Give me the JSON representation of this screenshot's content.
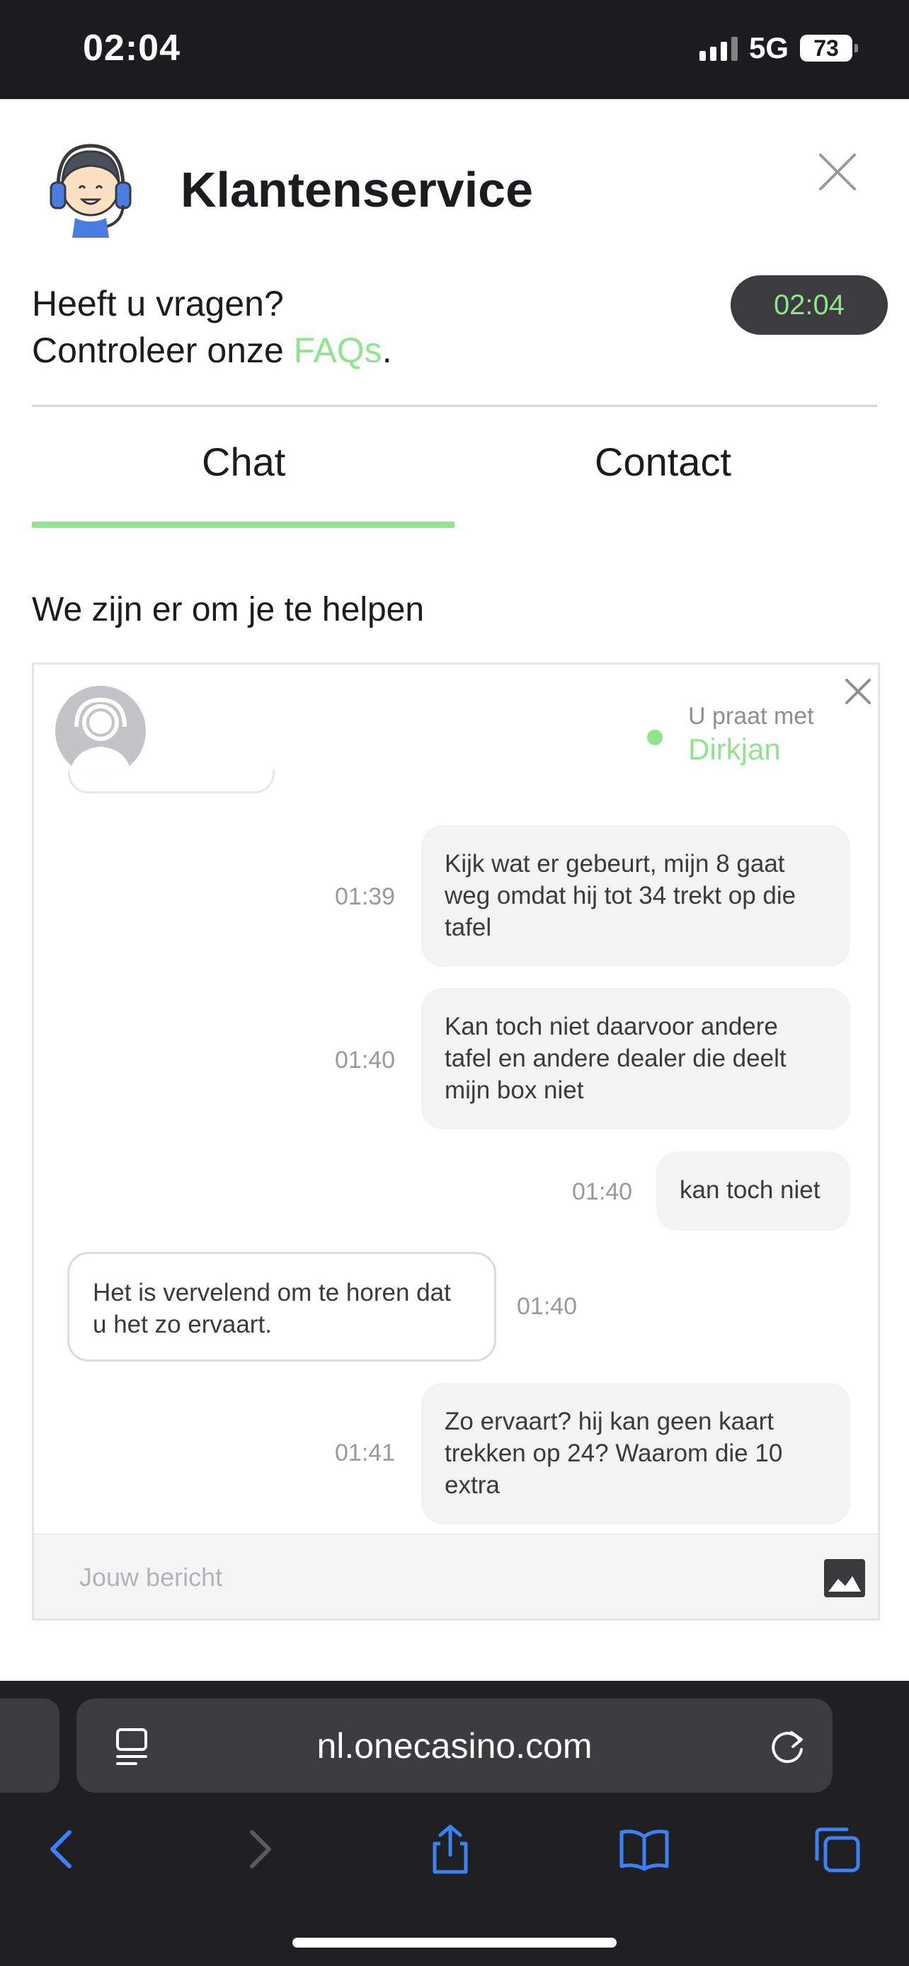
{
  "status_bar": {
    "time": "02:04",
    "network": "5G",
    "battery": "73"
  },
  "header": {
    "title": "Klantenservice"
  },
  "help": {
    "line1": "Heeft u vragen?",
    "line2_prefix": "Controleer onze ",
    "faq_link": "FAQs",
    "line2_suffix": "."
  },
  "clock": "02:04",
  "tabs": [
    {
      "label": "Chat",
      "active": true
    },
    {
      "label": "Contact",
      "active": false
    }
  ],
  "subheading": "We zijn er om je te helpen",
  "chat": {
    "talking_with_label": "U praat met",
    "agent_name": "Dirkjan",
    "messages": [
      {
        "direction": "out",
        "time": "01:39",
        "text": "Kijk wat er gebeurt, mijn 8 gaat weg omdat hij tot 34 trekt op die tafel"
      },
      {
        "direction": "out",
        "time": "01:40",
        "text": "Kan toch niet daarvoor andere tafel en andere dealer die deelt mijn box niet"
      },
      {
        "direction": "out",
        "time": "01:40",
        "text": "kan toch niet"
      },
      {
        "direction": "in",
        "time": "01:40",
        "text": "Het is vervelend om te horen dat u het zo ervaart."
      },
      {
        "direction": "out",
        "time": "01:41",
        "text": "Zo ervaart? hij kan geen kaart trekken op 24? Waarom die 10 extra"
      }
    ],
    "input_placeholder": "Jouw bericht"
  },
  "browser": {
    "url": "nl.onecasino.com"
  },
  "colors": {
    "accent": "#8ee58c",
    "dark": "#1c1c1e",
    "ios_blue": "#3b82f6"
  }
}
